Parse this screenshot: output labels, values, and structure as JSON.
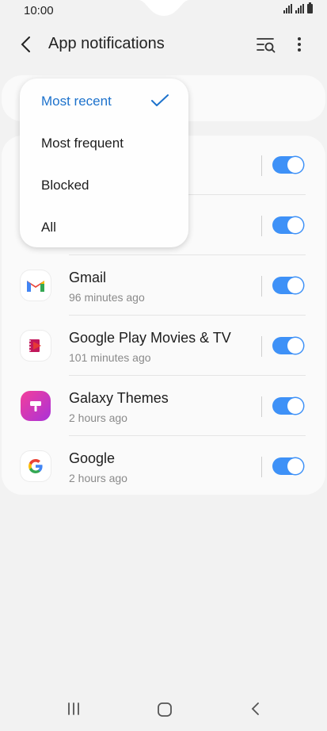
{
  "status": {
    "time": "10:00"
  },
  "header": {
    "title": "App notifications"
  },
  "filter": {
    "options": [
      {
        "label": "Most recent",
        "selected": true
      },
      {
        "label": "Most frequent",
        "selected": false
      },
      {
        "label": "Blocked",
        "selected": false
      },
      {
        "label": "All",
        "selected": false
      }
    ]
  },
  "apps": [
    {
      "name": "",
      "subtitle": "",
      "icon": "hidden-app-icon",
      "enabled": true
    },
    {
      "name": "",
      "subtitle": "",
      "icon": "hidden-app-icon",
      "enabled": true
    },
    {
      "name": "Gmail",
      "subtitle": "96 minutes ago",
      "icon": "gmail-icon",
      "enabled": true
    },
    {
      "name": "Google Play Movies & TV",
      "subtitle": "101 minutes ago",
      "icon": "play-movies-icon",
      "enabled": true
    },
    {
      "name": "Galaxy Themes",
      "subtitle": "2 hours ago",
      "icon": "galaxy-themes-icon",
      "enabled": true
    },
    {
      "name": "Google",
      "subtitle": "2 hours ago",
      "icon": "google-icon",
      "enabled": true
    }
  ],
  "colors": {
    "accent": "#3e91f7",
    "selected_text": "#1d72cc",
    "background": "#f2f2f2"
  }
}
